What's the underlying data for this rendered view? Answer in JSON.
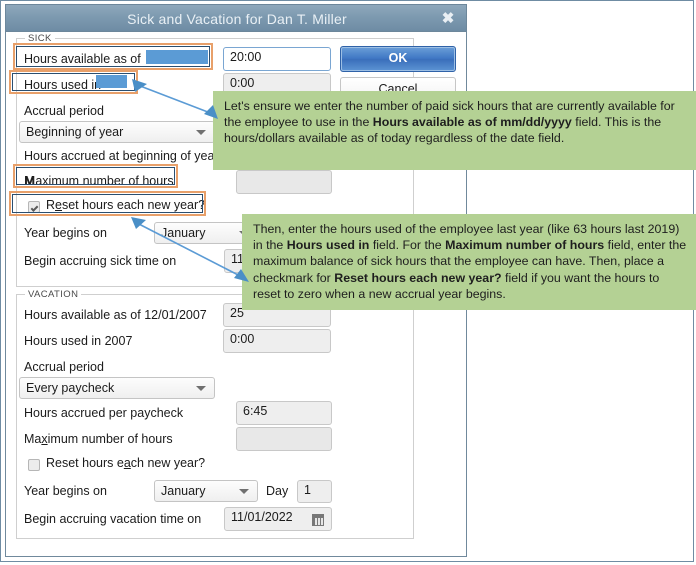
{
  "window": {
    "title": "Sick and Vacation for Dan T. Miller",
    "close_icon": "close-icon"
  },
  "buttons": {
    "ok": "OK",
    "cancel": "Cancel"
  },
  "sick": {
    "legend": "SICK",
    "hours_available_label": "Hours available as of",
    "hours_available_value": "20:00",
    "hours_used_label": "Hours used in",
    "hours_used_value": "0:00",
    "accrual_period_label": "Accrual period",
    "accrual_period_value": "Beginning of year",
    "hours_accrued_label": "Hours accrued at beginning of year",
    "max_hours_label": "Maximum number of hours",
    "max_hours_value": "",
    "reset_label": "Reset hours each new year?",
    "reset_checked": true,
    "year_begins_label": "Year begins on",
    "year_begins_value": "January",
    "begin_accruing_label": "Begin accruing sick time on",
    "begin_accruing_value": "11"
  },
  "vacation": {
    "legend": "VACATION",
    "hours_available_label": "Hours available as of 12/01/2007",
    "hours_available_value": "25",
    "hours_used_label": "Hours used in 2007",
    "hours_used_value": "0:00",
    "accrual_period_label": "Accrual period",
    "accrual_period_value": "Every paycheck",
    "hours_accrued_label": "Hours accrued per paycheck",
    "hours_accrued_value": "6:45",
    "max_hours_label": "Maximum number of hours",
    "max_hours_value": "",
    "reset_label": "Reset hours each new year?",
    "reset_checked": false,
    "year_begins_label": "Year begins on",
    "year_begins_value": "January",
    "day_label": "Day",
    "day_value": "1",
    "begin_accruing_label": "Begin accruing vacation time on",
    "begin_accruing_value": "11/01/2022",
    "calendar_icon": "calendar-icon"
  },
  "callouts": {
    "first": {
      "segments": [
        {
          "text": " Let's ensure we enter the number of paid sick hours that are currently available for the employee to use in the ",
          "bold": false
        },
        {
          "text": "Hours available as of mm/dd/yyyy",
          "bold": true
        },
        {
          "text": " field. This is the hours/dollars available as of today regardless of the date field.",
          "bold": false
        }
      ]
    },
    "second": {
      "segments": [
        {
          "text": "Then, enter the hours used of the employee last year (like 63 hours last 2019) in the ",
          "bold": false
        },
        {
          "text": "Hours used in",
          "bold": true
        },
        {
          "text": " field. For the ",
          "bold": false
        },
        {
          "text": "Maximum number of hours",
          "bold": true
        },
        {
          "text": " field, enter the maximum balance of sick hours that the employee can have. Then, place a checkmark for ",
          "bold": false
        },
        {
          "text": "Reset hours each new year?",
          "bold": true
        },
        {
          "text": " field if you want the hours to reset to zero when a new accrual year begins.",
          "bold": false
        }
      ]
    }
  },
  "colors": {
    "titlebar": "#7d9ab0",
    "callout_bg": "#b4d194",
    "highlight_border": "#e8a06a",
    "redaction": "#5b9bd5",
    "ok_button": "#3f77c4",
    "arrow": "#5b9bd5"
  }
}
